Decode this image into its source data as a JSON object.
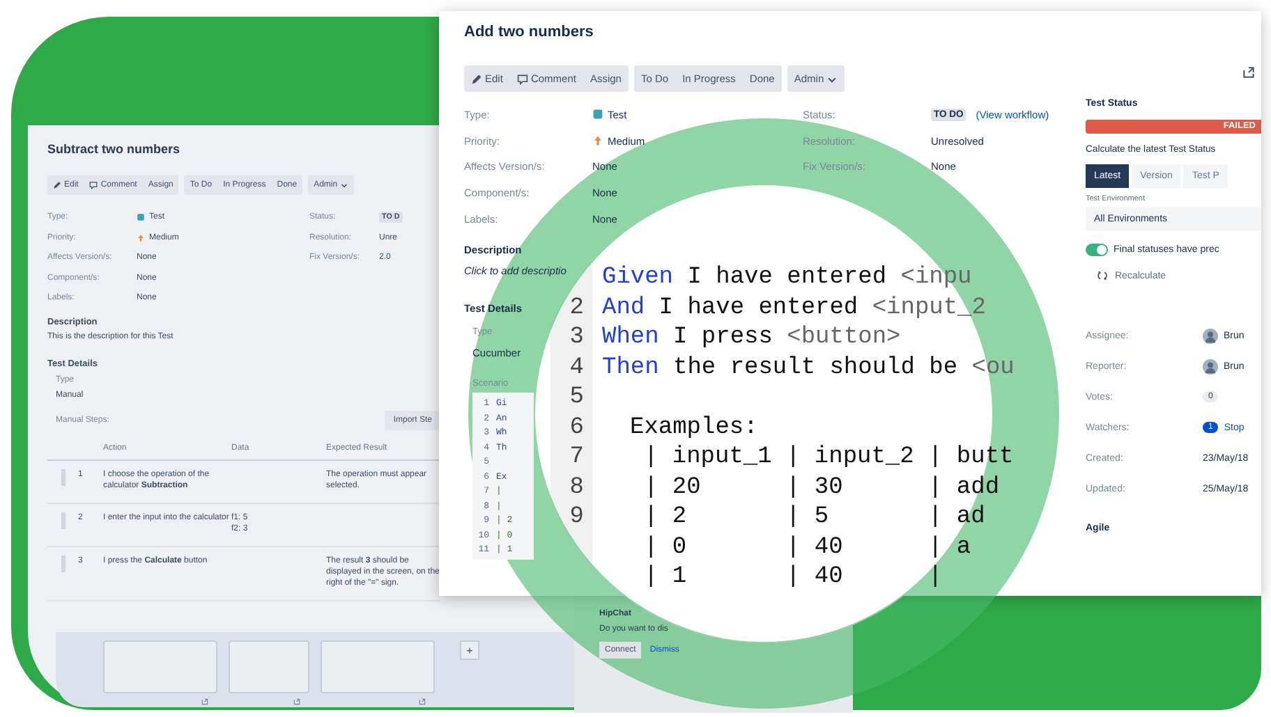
{
  "back_issue": {
    "title": "Subtract two numbers",
    "toolbar": [
      [
        {
          "label": "Edit",
          "kind": "edit"
        },
        {
          "label": "Comment",
          "kind": "comment"
        },
        {
          "label": "Assign",
          "kind": "plain"
        }
      ],
      [
        {
          "label": "To Do",
          "kind": "plain"
        },
        {
          "label": "In Progress",
          "kind": "plain"
        },
        {
          "label": "Done",
          "kind": "plain"
        }
      ],
      [
        {
          "label": "Admin",
          "kind": "menu"
        }
      ]
    ],
    "fields_left": [
      {
        "label": "Type:",
        "value": "Test",
        "kind": "type"
      },
      {
        "label": "Priority:",
        "value": "Medium",
        "kind": "priority"
      },
      {
        "label": "Affects Version/s:",
        "value": "None",
        "kind": "text"
      },
      {
        "label": "Component/s:",
        "value": "None",
        "kind": "text"
      },
      {
        "label": "Labels:",
        "value": "None",
        "kind": "text"
      }
    ],
    "fields_right": [
      {
        "label": "Status:",
        "value": "TO D",
        "kind": "status"
      },
      {
        "label": "Resolution:",
        "value": "Unre",
        "kind": "text"
      },
      {
        "label": "Fix Version/s:",
        "value": "2.0",
        "kind": "link"
      }
    ],
    "description": {
      "heading": "Description",
      "text": "This is the description for this Test"
    },
    "test_details": {
      "heading": "Test Details",
      "type_label": "Type",
      "type_value": "Manual",
      "steps_label": "Manual Steps:",
      "import_button": "Import Ste"
    },
    "steps": {
      "columns": [
        "Action",
        "Data",
        "Expected Result"
      ],
      "rows": [
        {
          "number": "1",
          "action": "I choose the operation of the calculator **Subtraction**",
          "data": [],
          "expected": "The operation must appear selected."
        },
        {
          "number": "2",
          "action": "I enter the input into the calculator",
          "data": [
            "f1: 5",
            "f2: 3"
          ],
          "expected": ""
        },
        {
          "number": "3",
          "action": "I press the **Calculate** button",
          "data": [],
          "expected": "The result **3** should be displayed in the screen, on the right of the \"=\" sign."
        }
      ]
    },
    "add_button": "+"
  },
  "front_issue": {
    "title": "Add two numbers",
    "toolbar": [
      [
        {
          "label": "Edit",
          "kind": "edit"
        },
        {
          "label": "Comment",
          "kind": "comment"
        },
        {
          "label": "Assign",
          "kind": "plain"
        }
      ],
      [
        {
          "label": "To Do",
          "kind": "plain"
        },
        {
          "label": "In Progress",
          "kind": "plain"
        },
        {
          "label": "Done",
          "kind": "plain"
        }
      ],
      [
        {
          "label": "Admin",
          "kind": "menu"
        }
      ]
    ],
    "fields_left": [
      {
        "label": "Type:",
        "value": "Test",
        "kind": "type"
      },
      {
        "label": "Priority:",
        "value": "Medium",
        "kind": "priority"
      },
      {
        "label": "Affects Version/s:",
        "value": "None",
        "kind": "text"
      },
      {
        "label": "Component/s:",
        "value": "None",
        "kind": "text"
      },
      {
        "label": "Labels:",
        "value": "None",
        "kind": "text"
      }
    ],
    "fields_right": [
      {
        "label": "Status:",
        "value": "TO DO",
        "kind": "status",
        "link": "(View workflow)"
      },
      {
        "label": "Resolution:",
        "value": "Unresolved",
        "kind": "text"
      },
      {
        "label": "Fix Version/s:",
        "value": "None",
        "kind": "text"
      }
    ],
    "description": {
      "heading": "Description",
      "placeholder": "Click to add descriptio"
    },
    "test_details": {
      "heading": "Test Details",
      "type_label": "Type",
      "type_value": "Cucumber",
      "scenario_label": "Scenario"
    },
    "scenario_lines": [
      {
        "number": "1",
        "kind": "keyword",
        "text": "Gi"
      },
      {
        "number": "2",
        "kind": "keyword",
        "text": "An"
      },
      {
        "number": "3",
        "kind": "keyword",
        "text": "Wh"
      },
      {
        "number": "4",
        "kind": "keyword",
        "text": "Th"
      },
      {
        "number": "5",
        "kind": "blank"
      },
      {
        "number": "6",
        "kind": "keyword",
        "text": "Ex"
      },
      {
        "number": "7",
        "kind": "table",
        "text": "|"
      },
      {
        "number": "8",
        "kind": "table",
        "text": "|"
      },
      {
        "number": "9",
        "kind": "table",
        "text": "| 2"
      },
      {
        "number": "10",
        "kind": "table",
        "text": "| 0"
      },
      {
        "number": "11",
        "kind": "table",
        "text": "| 1"
      }
    ],
    "test_status": {
      "heading": "Test Status",
      "result": "FAILED",
      "calc_text": "Calculate the latest Test Status",
      "tabs": [
        {
          "label": "Latest",
          "selected": true
        },
        {
          "label": "Version",
          "selected": false
        },
        {
          "label": "Test P",
          "selected": false
        }
      ],
      "env_label": "Test Environment",
      "env_value": "All Environments",
      "toggle": {
        "on": true,
        "label": "Final statuses have prec"
      },
      "recalculate": "Recalculate"
    },
    "people": [
      {
        "label": "Assignee:",
        "value": "Brun",
        "kind": "user"
      },
      {
        "label": "Reporter:",
        "value": "Brun",
        "kind": "user"
      },
      {
        "label": "Votes:",
        "value": "0",
        "kind": "count"
      },
      {
        "label": "Watchers:",
        "value": "1",
        "kind": "watch",
        "link": "Stop"
      },
      {
        "label": "Created:",
        "value": "23/May/18",
        "kind": "text"
      },
      {
        "label": "Updated:",
        "value": "25/May/18",
        "kind": "text"
      }
    ],
    "agile_heading": "Agile"
  },
  "hipchat": {
    "title": "HipChat",
    "text": "Do you want to dis",
    "buttons": [
      {
        "label": "Connect",
        "kind": "button"
      },
      {
        "label": "Dismiss",
        "kind": "link"
      }
    ]
  },
  "magnifier": {
    "lines": [
      {
        "kind": "step",
        "keyword": "Given",
        "text": "I have entered",
        "param": "<inpu"
      },
      {
        "number": "2",
        "kind": "step",
        "keyword": "And",
        "text": "I have entered",
        "param": "<input_2"
      },
      {
        "number": "3",
        "kind": "step",
        "keyword": "When",
        "text": "I press",
        "param": "<button>"
      },
      {
        "number": "4",
        "kind": "step",
        "keyword": "Then",
        "text": "the result should be",
        "param": "<ou"
      },
      {
        "number": "5",
        "kind": "blank"
      },
      {
        "number": "6",
        "kind": "heading",
        "text": "Examples:"
      },
      {
        "number": "7",
        "kind": "table",
        "text": "| input_1 | input_2 | butt"
      },
      {
        "number": "8",
        "kind": "table",
        "text": "| 20      | 30      | add"
      },
      {
        "number": "9",
        "kind": "table",
        "text": "| 2       | 5       | ad"
      },
      {
        "kind": "table",
        "text": "| 0       | 40      | a"
      },
      {
        "kind": "table",
        "text": "| 1       | 40      |"
      }
    ]
  }
}
